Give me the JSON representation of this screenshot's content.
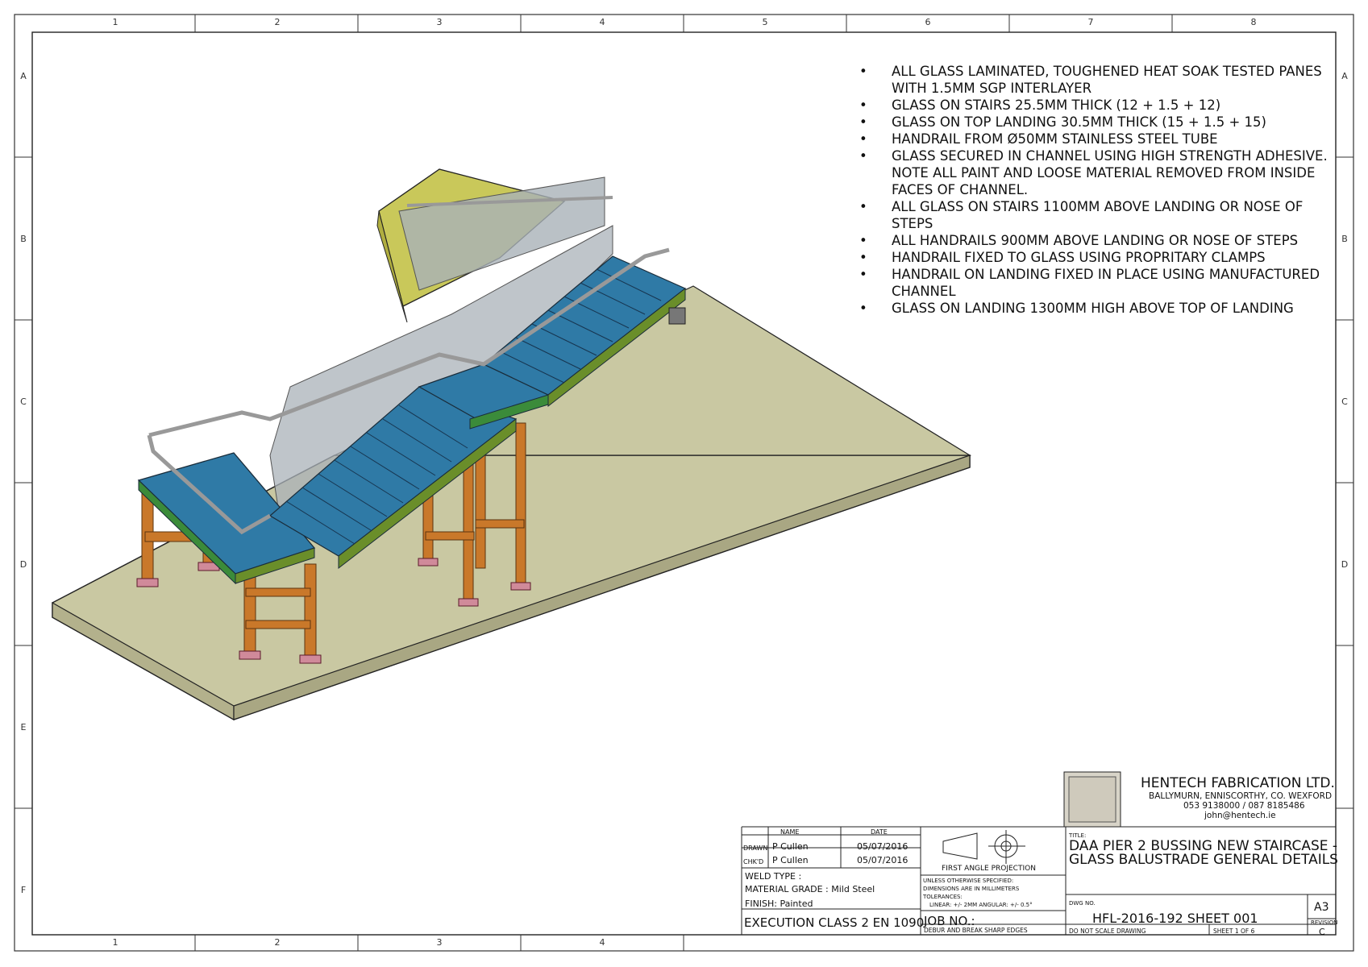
{
  "border": {
    "columns": [
      "1",
      "2",
      "3",
      "4",
      "5",
      "6",
      "7",
      "8"
    ],
    "bottom_columns": [
      "1",
      "2",
      "3",
      "4"
    ],
    "rows": [
      "A",
      "B",
      "C",
      "D",
      "E",
      "F"
    ]
  },
  "notes": [
    "ALL GLASS LAMINATED, TOUGHENED HEAT SOAK TESTED PANES WITH 1.5MM SGP INTERLAYER",
    "GLASS ON STAIRS 25.5MM THICK (12 + 1.5 + 12)",
    "GLASS ON TOP LANDING 30.5MM THICK (15 + 1.5 + 15)",
    "HANDRAIL FROM Ø50MM STAINLESS STEEL TUBE",
    "GLASS SECURED IN CHANNEL USING HIGH STRENGTH ADHESIVE. NOTE ALL PAINT AND LOOSE MATERIAL REMOVED FROM INSIDE FACES OF CHANNEL.",
    "ALL GLASS ON STAIRS 1100MM ABOVE LANDING OR NOSE OF STEPS",
    "ALL HANDRAILS 900MM ABOVE LANDING OR NOSE OF STEPS",
    "HANDRAIL FIXED TO GLASS USING PROPRITARY CLAMPS",
    "HANDRAIL ON LANDING FIXED IN PLACE USING MANUFACTURED CHANNEL",
    "GLASS ON LANDING 1300MM HIGH ABOVE TOP OF LANDING"
  ],
  "title_block": {
    "company": {
      "name": "HENTECH FABRICATION LTD.",
      "address": "BALLYMURN, ENNISCORTHY, CO. WEXFORD",
      "phone": "053 9138000 / 087 8185486",
      "email": "john@hentech.ie"
    },
    "approval": {
      "col_name": "NAME",
      "col_date": "DATE",
      "drawn_label": "DRAWN",
      "drawn_name": "P Cullen",
      "drawn_date": "05/07/2016",
      "checked_label": "CHK'D",
      "checked_name": "P Cullen",
      "checked_date": "05/07/2016"
    },
    "weld_type": "WELD TYPE :",
    "material_grade": "MATERIAL GRADE : Mild Steel",
    "finish": "FINISH: Painted",
    "execution_class": "EXECUTION CLASS 2 EN 1090",
    "projection": "FIRST ANGLE PROJECTION",
    "unless_note": "UNLESS OTHERWISE SPECIFIED:",
    "dims_note": "DIMENSIONS ARE IN MILLIMETERS",
    "tolerances_label": "TOLERANCES:",
    "tolerances": "LINEAR: +/- 2MM     ANGULAR: +/- 0.5°",
    "job_no_label": "JOB NO.:",
    "debur": "DEBUR AND BREAK SHARP EDGES",
    "title_label": "TITLE:",
    "title": "DAA PIER 2 BUSSING NEW STAIRCASE - GLASS BALUSTRADE GENERAL DETAILS",
    "dwg_no_label": "DWG NO.",
    "dwg_no": "HFL-2016-192  SHEET 001",
    "size": "A3",
    "revision_label": "REVISION",
    "revision": "C",
    "scale_note": "DO NOT SCALE DRAWING",
    "sheet": "SHEET 1 OF 6"
  },
  "colors": {
    "stair_blue": "#2f7aa6",
    "frame_orange": "#c9782a",
    "slab": "#c9c8a2",
    "landing_yellow": "#c9c85a",
    "glass": "#a9b2b8"
  }
}
